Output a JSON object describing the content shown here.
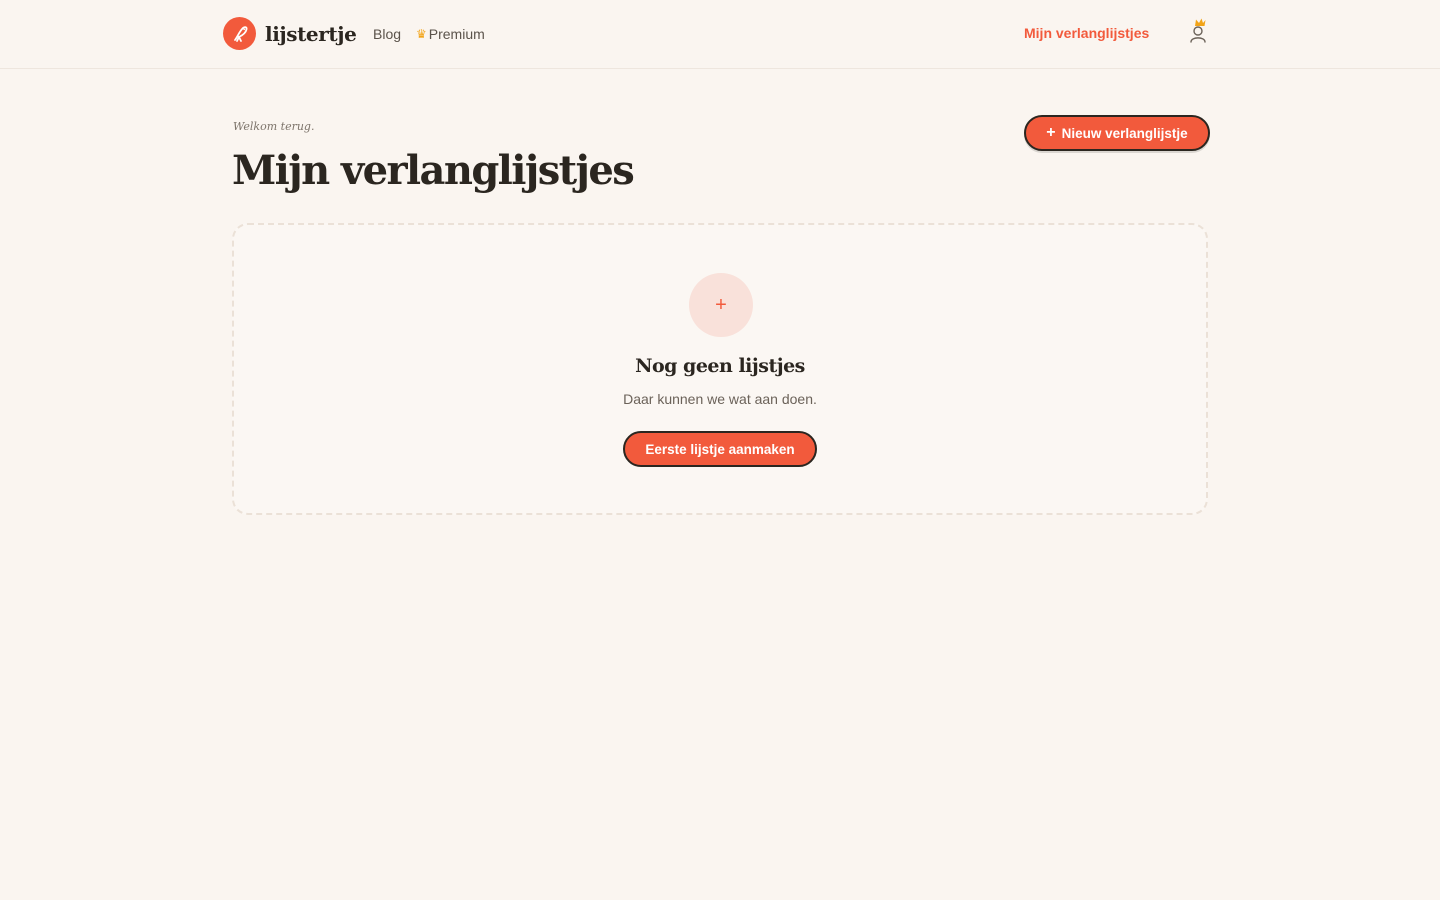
{
  "header": {
    "brand_name": "lijstertje",
    "nav": {
      "blog": "Blog",
      "premium": "Premium",
      "wishlists": "Mijn verlanglijstjes"
    }
  },
  "main": {
    "welcome": "Welkom terug.",
    "title": "Mijn verlanglijstjes",
    "new_button": "Nieuw verlanglijstje",
    "empty_state": {
      "title": "Nog geen lijstjes",
      "subtitle": "Daar kunnen we wat aan doen.",
      "button": "Eerste lijstje aanmaken"
    }
  },
  "icons": {
    "logo": "bird-logo-icon",
    "premium": "crown-icon",
    "user": "user-icon",
    "user_badge": "crown-icon",
    "new": "plus-icon",
    "empty": "plus-icon"
  },
  "colors": {
    "accent": "#f25a3c",
    "background": "#faf5f0",
    "text": "#2b2620",
    "premium": "#f2a418"
  }
}
